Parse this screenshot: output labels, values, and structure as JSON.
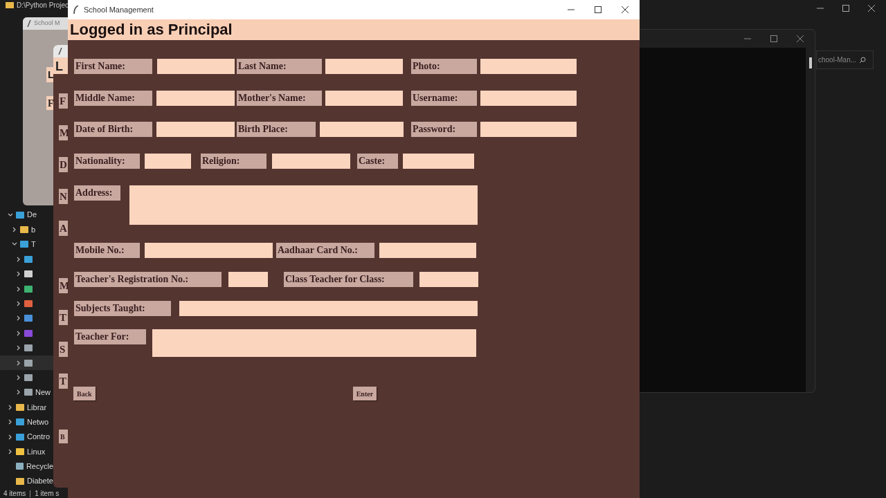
{
  "explorer": {
    "path": "D:\\Python Projec",
    "tree": [
      {
        "label": "De",
        "color": "#3aa0d8",
        "expanded": true,
        "children": [
          {
            "label": "b",
            "color": "#e8b84a",
            "expanded": false
          },
          {
            "label": "T",
            "color": "#3aa0d8",
            "expanded": true,
            "children": [
              {
                "color": "#3aa0d8",
                "expanded": false,
                "selected": false
              },
              {
                "color": "#d0d0d0",
                "expanded": false,
                "selected": false
              },
              {
                "color": "#3cb371",
                "expanded": false,
                "selected": false
              },
              {
                "color": "#e06040",
                "expanded": false,
                "selected": false
              },
              {
                "color": "#4a90d9",
                "expanded": false,
                "selected": false
              },
              {
                "color": "#8a4ad9",
                "expanded": false,
                "selected": false
              },
              {
                "color": "#9aa4aa",
                "expanded": false,
                "selected": false
              },
              {
                "color": "#9aa4aa",
                "expanded": false,
                "selected": true
              },
              {
                "color": "#9aa4aa",
                "expanded": false,
                "selected": false
              },
              {
                "label": "New",
                "color": "#9aa4aa",
                "expanded": false,
                "selected": false
              }
            ]
          }
        ]
      },
      {
        "label": "Librar",
        "color": "#e8b84a",
        "expanded": false
      },
      {
        "label": "Netwo",
        "color": "#3aa0d8",
        "expanded": false
      },
      {
        "label": "Contro",
        "color": "#3aa0d8",
        "expanded": false
      },
      {
        "label": "Linux",
        "color": "#f0c040",
        "expanded": false
      },
      {
        "label": "Recycle",
        "color": "#8ab0c0"
      },
      {
        "label": "Diabete",
        "color": "#e8b84a"
      }
    ],
    "status": [
      "4 items",
      "1 item s"
    ],
    "search": "chool-Man..."
  },
  "back_windows": [
    {
      "title": "School M",
      "labels": [
        "L",
        "F"
      ]
    },
    {
      "header": "L",
      "labels": [
        "F",
        "M",
        "D",
        "N",
        "A",
        "M",
        "T",
        "S",
        "T"
      ],
      "button": "B"
    }
  ],
  "window": {
    "title": "School Management"
  },
  "header": "Logged in as Principal",
  "form_rows": [
    {
      "fields": [
        {
          "label": "First Name:",
          "kind": "entry"
        },
        {
          "label": "Last Name:",
          "kind": "entry"
        },
        {
          "label": "Photo:",
          "kind": "entry"
        }
      ]
    },
    {
      "fields": [
        {
          "label": "Middle Name:",
          "kind": "entry"
        },
        {
          "label": "Mother's Name:",
          "kind": "entry"
        },
        {
          "label": "Username:",
          "kind": "entry"
        }
      ]
    },
    {
      "fields": [
        {
          "label": "Date of Birth:",
          "kind": "entry"
        },
        {
          "label": "Birth Place:",
          "kind": "entry"
        },
        {
          "label": "Password:",
          "kind": "entry"
        }
      ]
    },
    {
      "fields": [
        {
          "label": "Nationality:",
          "kind": "entry"
        },
        {
          "label": "Religion:",
          "kind": "entry"
        },
        {
          "label": "Caste:",
          "kind": "entry"
        }
      ]
    },
    {
      "fields": [
        {
          "label": "Address:",
          "kind": "text"
        }
      ]
    },
    {
      "fields": [
        {
          "label": "Mobile No.:",
          "kind": "entry"
        },
        {
          "label": "Aadhaar Card No.:",
          "kind": "entry"
        }
      ]
    },
    {
      "fields": [
        {
          "label": "Teacher's Registration No.:",
          "kind": "entry"
        },
        {
          "label": "Class Teacher for Class:",
          "kind": "entry"
        }
      ]
    },
    {
      "fields": [
        {
          "label": "Subjects Taught:",
          "kind": "entry"
        }
      ]
    },
    {
      "fields": [
        {
          "label": "Teacher For:",
          "kind": "text"
        }
      ]
    }
  ],
  "buttons": [
    "Back",
    "Enter"
  ]
}
